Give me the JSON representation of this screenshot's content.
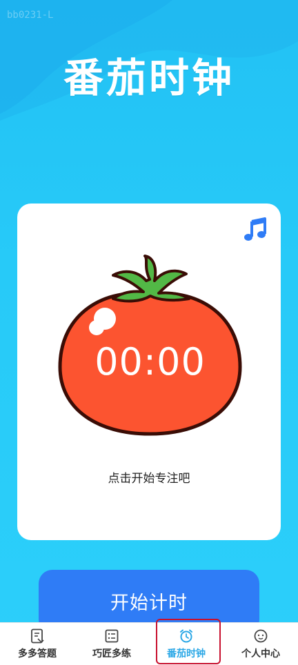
{
  "watermark": "bb0231-L",
  "header": {
    "title": "番茄时钟"
  },
  "card": {
    "music_icon": "music-note-icon",
    "timer": "00:00",
    "hint": "点击开始专注吧"
  },
  "actions": {
    "start_label": "开始计时"
  },
  "tabs": [
    {
      "label": "多多答题",
      "icon": "document-icon",
      "active": false
    },
    {
      "label": "巧匠多练",
      "icon": "list-icon",
      "active": false
    },
    {
      "label": "番茄时钟",
      "icon": "alarm-clock-icon",
      "active": true
    },
    {
      "label": "个人中心",
      "icon": "face-icon",
      "active": false
    }
  ],
  "colors": {
    "background": "#23c6f6",
    "tomato": "#fc5430",
    "leaf": "#52b846",
    "button": "#2f7cf6",
    "active_tab": "#2aa7e6",
    "highlight": "#c8102e"
  }
}
